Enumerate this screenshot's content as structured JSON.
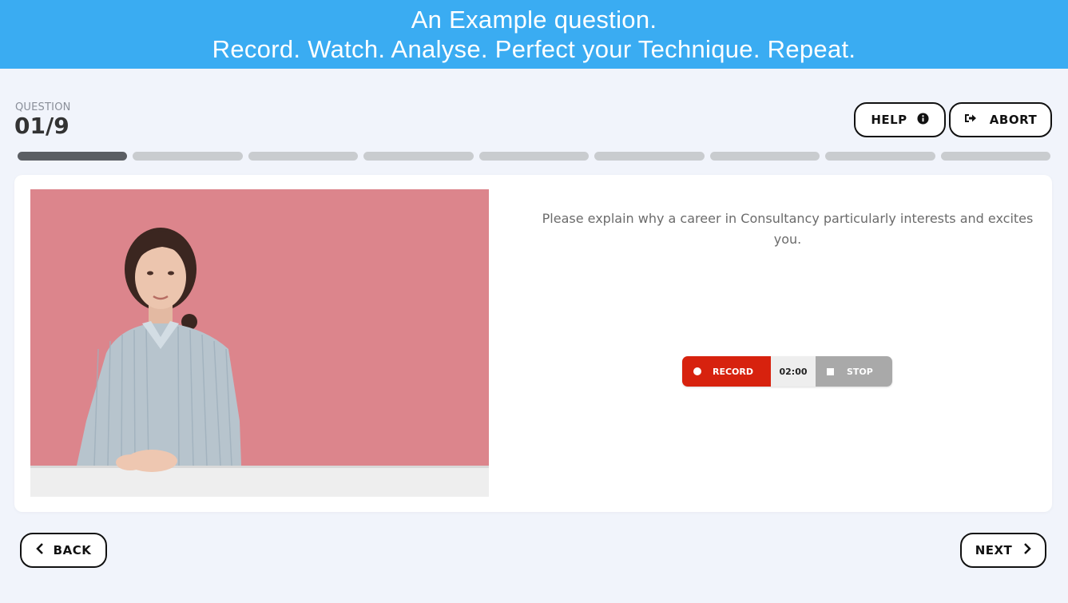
{
  "banner": {
    "line1": "An Example question.",
    "line2": "Record. Watch. Analyse. Perfect your Technique. Repeat."
  },
  "question": {
    "label": "QUESTION",
    "number": "01/9",
    "text": "Please explain why a career in Consultancy particularly interests and excites you."
  },
  "header_buttons": {
    "help_label": "HELP",
    "abort_label": "ABORT",
    "help_icon": "info-icon",
    "abort_icon": "sign-out-icon"
  },
  "progress": {
    "current": 1,
    "total": 9
  },
  "recorder": {
    "record_label": "RECORD",
    "timer": "02:00",
    "stop_label": "STOP"
  },
  "nav": {
    "back_label": "BACK",
    "next_label": "NEXT"
  },
  "colors": {
    "banner": "#3aacf2",
    "record": "#d7220e",
    "stop": "#a9a9a9",
    "photo_background": "#dc858c",
    "progress_active": "#5b5e63",
    "progress_inactive": "#c9cccf"
  }
}
